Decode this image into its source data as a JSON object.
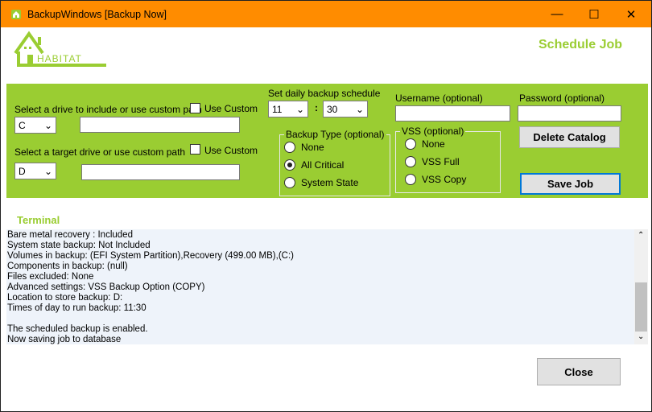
{
  "window": {
    "title": "BackupWindows [Backup Now]",
    "minimize": "—",
    "maximize": "☐",
    "close": "✕"
  },
  "header": {
    "logo_text": "Habitat",
    "heading": "Schedule Job"
  },
  "source": {
    "label": "Select a drive to include or use custom path",
    "drive": "C",
    "use_custom_label": "Use Custom",
    "use_custom_checked": false,
    "path": ""
  },
  "target": {
    "label": "Select a target drive or use custom path",
    "drive": "D",
    "use_custom_label": "Use Custom",
    "use_custom_checked": false,
    "path": ""
  },
  "schedule": {
    "label": "Set daily backup schedule",
    "hour": "11",
    "separator": ":",
    "minute": "30"
  },
  "credentials": {
    "username_label": "Username (optional)",
    "username": "",
    "password_label": "Password (optional)",
    "password": ""
  },
  "backup_type": {
    "title": "Backup Type (optional)",
    "options": [
      "None",
      "All Critical",
      "System State"
    ],
    "selected": "All Critical"
  },
  "vss": {
    "title": "VSS (optional)",
    "options": [
      "None",
      "VSS Full",
      "VSS Copy"
    ],
    "selected": ""
  },
  "buttons": {
    "delete_catalog": "Delete Catalog",
    "save_job": "Save Job",
    "close": "Close"
  },
  "terminal": {
    "label": "Terminal",
    "lines": [
      "Bare metal recovery : Included",
      "System state backup: Not Included",
      "Volumes in backup: (EFI System Partition),Recovery (499.00 MB),(C:)",
      "Components in backup: (null)",
      "Files excluded: None",
      "Advanced settings: VSS Backup Option (COPY)",
      "Location to store backup: D:",
      "Times of day to run backup: 11:30",
      "",
      "The scheduled backup is enabled.",
      "Now saving job to database"
    ]
  },
  "colors": {
    "title_bar": "#FF8C00",
    "accent_green": "#9ACD32",
    "focus_border": "#0078D7"
  }
}
